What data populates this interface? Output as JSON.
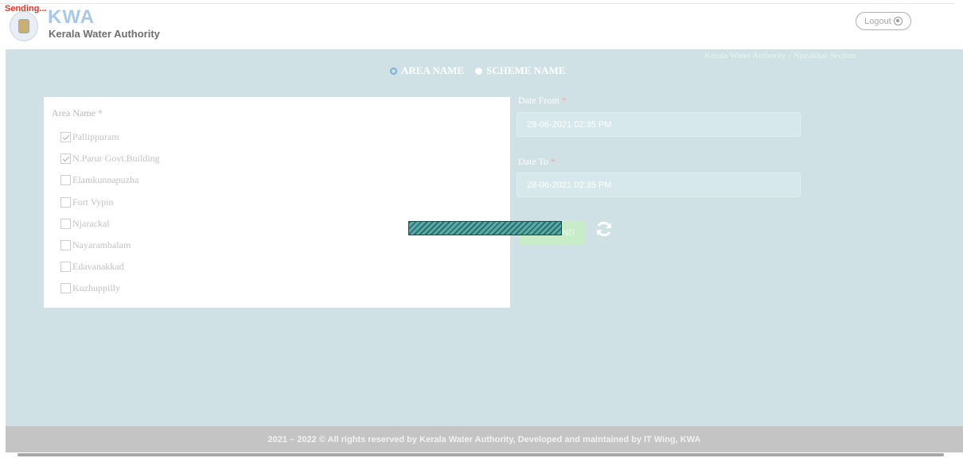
{
  "status": {
    "sending": "Sending..."
  },
  "header": {
    "abbr": "KWA",
    "name": "Kerala Water Authority",
    "logout_label": "Logout"
  },
  "section_label": "Kerala Water Authority : Njarakkal Section",
  "radio": {
    "area": "AREA NAME",
    "scheme": "SCHEME NAME",
    "selected": "area"
  },
  "area": {
    "label": "Area Name",
    "required_mark": "*",
    "items": [
      {
        "label": "Pallippuram",
        "checked": true
      },
      {
        "label": "N.Parur Govt.Building",
        "checked": true
      },
      {
        "label": "Elamkunnapuzha",
        "checked": false
      },
      {
        "label": "Fort Vypin",
        "checked": false
      },
      {
        "label": "Njarackal",
        "checked": false
      },
      {
        "label": "Nayarambalam",
        "checked": false
      },
      {
        "label": "Edavanakkad",
        "checked": false
      },
      {
        "label": "Kuzhuppilly",
        "checked": false
      }
    ]
  },
  "date_from": {
    "label": "Date From",
    "value": "28-06-2021 02:35 PM"
  },
  "date_to": {
    "label": "Date To",
    "value": "28-06-2021 02:35 PM"
  },
  "actions": {
    "submit_label": "... ND"
  },
  "footer": {
    "text": "2021 – 2022 © All rights reserved by Kerala Water Authority, Developed and maintained by IT Wing, KWA"
  },
  "colors": {
    "main_bg": "#cfe1e5",
    "footer_bg": "#c4c4c4",
    "loading_bar": "#3a8a8c",
    "brand": "#a9c8e8",
    "sending": "#e8322a"
  }
}
